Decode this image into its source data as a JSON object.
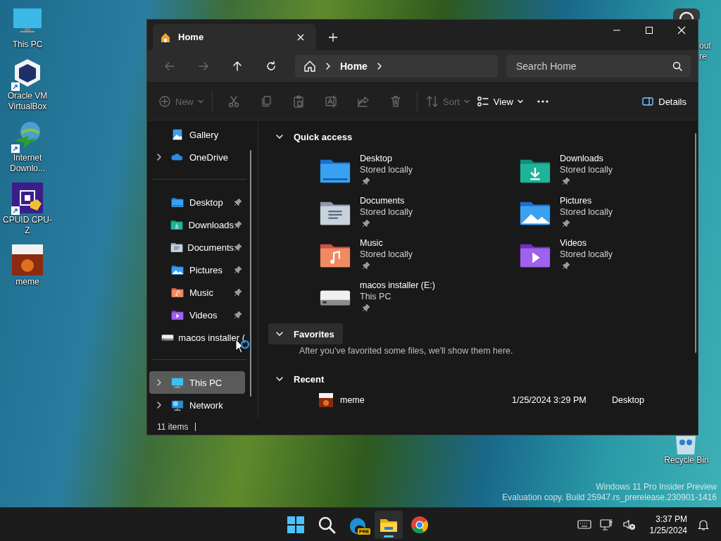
{
  "desktop_icons": [
    {
      "label": "This PC",
      "kind": "monitor"
    },
    {
      "label": "Oracle VM VirtualBox",
      "kind": "cube",
      "shortcut": true
    },
    {
      "label": "Internet Downlo...",
      "kind": "globe",
      "shortcut": true
    },
    {
      "label": "CPUID CPU-Z",
      "kind": "chip",
      "shortcut": true
    },
    {
      "label": "meme",
      "kind": "image"
    }
  ],
  "desktop_right_icons": [
    {
      "label": "out re",
      "kind": "partial"
    },
    {
      "label": "Recycle Bin",
      "kind": "bin"
    }
  ],
  "watermark": [
    "Windows 11 Pro Insider Preview",
    "Evaluation copy. Build 25947.rs_prerelease.230901-1416"
  ],
  "window": {
    "tabs": [
      {
        "label": "Home",
        "selected": true
      }
    ],
    "nav_buttons": [
      {
        "kind": "back",
        "disabled": true
      },
      {
        "kind": "forward",
        "disabled": true
      },
      {
        "kind": "up",
        "disabled": false
      },
      {
        "kind": "refresh",
        "disabled": false
      }
    ],
    "breadcrumb": [
      "Home"
    ],
    "search": {
      "placeholder": "Search Home"
    },
    "commands": [
      {
        "kind": "new",
        "label": "New",
        "disabled": true
      },
      {
        "kind": "cut",
        "disabled": true
      },
      {
        "kind": "copy",
        "disabled": true
      },
      {
        "kind": "paste",
        "disabled": true
      },
      {
        "kind": "rename",
        "disabled": true
      },
      {
        "kind": "share",
        "disabled": true
      },
      {
        "kind": "delete",
        "disabled": true
      },
      {
        "kind": "sort",
        "label": "Sort",
        "disabled": true
      },
      {
        "kind": "view",
        "label": "View",
        "disabled": false
      },
      {
        "kind": "more",
        "disabled": false
      }
    ],
    "details_button": "Details",
    "sidebar": [
      {
        "label": "Gallery",
        "kind": "gallery",
        "expandable": false,
        "pinned": false,
        "selected": false
      },
      {
        "label": "OneDrive",
        "kind": "cloud",
        "expandable": true,
        "pinned": false,
        "selected": false
      },
      {
        "kind": "divider"
      },
      {
        "label": "Desktop",
        "kind": "desktop",
        "expandable": false,
        "pinned": true,
        "selected": false
      },
      {
        "label": "Downloads",
        "kind": "downloads",
        "expandable": false,
        "pinned": true,
        "selected": false
      },
      {
        "label": "Documents",
        "kind": "documents",
        "expandable": false,
        "pinned": true,
        "selected": false
      },
      {
        "label": "Pictures",
        "kind": "pictures",
        "expandable": false,
        "pinned": true,
        "selected": false
      },
      {
        "label": "Music",
        "kind": "music",
        "expandable": false,
        "pinned": true,
        "selected": false
      },
      {
        "label": "Videos",
        "kind": "videos",
        "expandable": false,
        "pinned": true,
        "selected": false
      },
      {
        "label": "macos installer (",
        "kind": "drive",
        "expandable": false,
        "pinned": false,
        "selected": false
      },
      {
        "kind": "divider"
      },
      {
        "label": "This PC",
        "kind": "monitor",
        "expandable": true,
        "pinned": false,
        "selected": true
      },
      {
        "label": "Network",
        "kind": "network",
        "expandable": true,
        "pinned": false,
        "selected": false
      }
    ],
    "status": "11 items",
    "sections": [
      {
        "title": "Quick access",
        "expanded": true,
        "hovered": false,
        "kind": "grid",
        "items": [
          {
            "name": "Desktop",
            "sub": "Stored locally",
            "kind": "desktop",
            "pinned": true
          },
          {
            "name": "Downloads",
            "sub": "Stored locally",
            "kind": "downloads",
            "pinned": true
          },
          {
            "name": "Documents",
            "sub": "Stored locally",
            "kind": "documents",
            "pinned": true
          },
          {
            "name": "Pictures",
            "sub": "Stored locally",
            "kind": "pictures",
            "pinned": true
          },
          {
            "name": "Music",
            "sub": "Stored locally",
            "kind": "music",
            "pinned": true
          },
          {
            "name": "Videos",
            "sub": "Stored locally",
            "kind": "videos",
            "pinned": true
          },
          {
            "name": "macos installer (E:)",
            "sub": "This PC",
            "kind": "drive",
            "pinned": true
          }
        ]
      },
      {
        "title": "Favorites",
        "expanded": true,
        "hovered": true,
        "kind": "message",
        "message": "After you've favorited some files, we'll show them here."
      },
      {
        "title": "Recent",
        "expanded": true,
        "hovered": false,
        "kind": "list",
        "rows": [
          {
            "name": "meme",
            "date": "1/25/2024 3:29 PM",
            "location": "Desktop"
          }
        ]
      }
    ]
  },
  "taskbar": {
    "apps": [
      {
        "kind": "start",
        "active": false
      },
      {
        "kind": "search",
        "active": false
      },
      {
        "kind": "edge",
        "badge": "PRE",
        "active": false
      },
      {
        "kind": "explorer",
        "active": true
      },
      {
        "kind": "chrome",
        "active": false
      }
    ],
    "tray": [
      {
        "kind": "keyboard"
      },
      {
        "kind": "network"
      },
      {
        "kind": "muted"
      }
    ],
    "time": "3:37 PM",
    "date": "1/25/2024"
  }
}
